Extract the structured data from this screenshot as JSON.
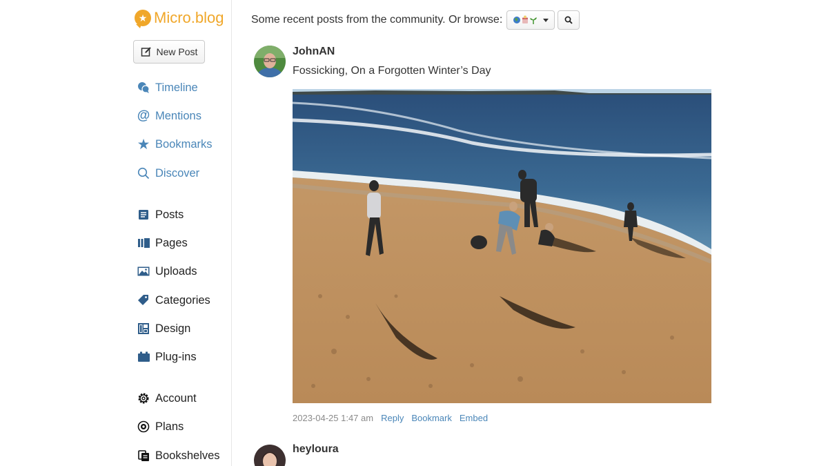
{
  "app": {
    "name": "Micro.blog"
  },
  "sidebar": {
    "new_post_label": "New Post",
    "primary": [
      {
        "label": "Timeline",
        "icon": "chat-bubbles-icon"
      },
      {
        "label": "Mentions",
        "icon": "at-sign-icon"
      },
      {
        "label": "Bookmarks",
        "icon": "star-icon"
      },
      {
        "label": "Discover",
        "icon": "search-icon"
      }
    ],
    "blog": [
      {
        "label": "Posts",
        "icon": "document-icon"
      },
      {
        "label": "Pages",
        "icon": "pages-icon"
      },
      {
        "label": "Uploads",
        "icon": "image-icon"
      },
      {
        "label": "Categories",
        "icon": "tag-icon"
      },
      {
        "label": "Design",
        "icon": "layout-icon"
      },
      {
        "label": "Plug-ins",
        "icon": "plugin-icon"
      }
    ],
    "account": [
      {
        "label": "Account",
        "icon": "gear-icon"
      },
      {
        "label": "Plans",
        "icon": "plans-icon"
      },
      {
        "label": "Bookshelves",
        "icon": "books-icon"
      }
    ]
  },
  "main": {
    "intro": "Some recent posts from the community. Or browse:",
    "posts": [
      {
        "author": "JohnAN",
        "title": "Fossicking, On a Forgotten Winter’s Day",
        "timestamp": "2023-04-25 1:47 am",
        "actions": [
          "Reply",
          "Bookmark",
          "Embed"
        ]
      },
      {
        "author": "heyloura"
      }
    ]
  },
  "colors": {
    "brand": "#f0a72a",
    "link": "#4a86b8"
  }
}
